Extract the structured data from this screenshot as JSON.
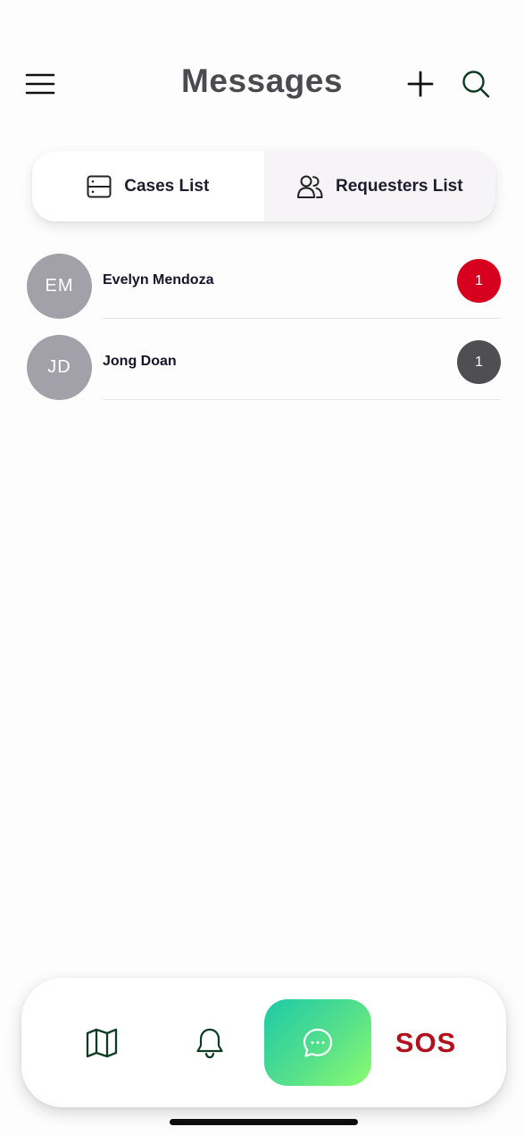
{
  "header": {
    "title": "Messages",
    "menu_icon": "hamburger-menu-icon",
    "add_icon": "plus-icon",
    "search_icon": "search-icon"
  },
  "tabs": [
    {
      "label": "Cases List",
      "icon": "server-list-icon",
      "active": false
    },
    {
      "label": "Requesters List",
      "icon": "users-icon",
      "active": true
    }
  ],
  "conversations": [
    {
      "initials": "EM",
      "name": "Evelyn Mendoza",
      "unread": "1",
      "badge_color": "#d7001f"
    },
    {
      "initials": "JD",
      "name": "Jong Doan",
      "unread": "1",
      "badge_color": "#4f4e53"
    }
  ],
  "bottom_nav": {
    "items": [
      {
        "icon": "map-icon"
      },
      {
        "icon": "bell-icon"
      },
      {
        "icon": "chat-bubble-icon",
        "active": true
      },
      {
        "label": "SOS"
      }
    ]
  },
  "colors": {
    "title": "#4b4a4e",
    "sos": "#b2101c",
    "avatar": "#a2a1a9",
    "accent_gradient_start": "#1ccaa6",
    "accent_gradient_end": "#8afc6e",
    "icon_dark_green": "#0e3b22"
  }
}
